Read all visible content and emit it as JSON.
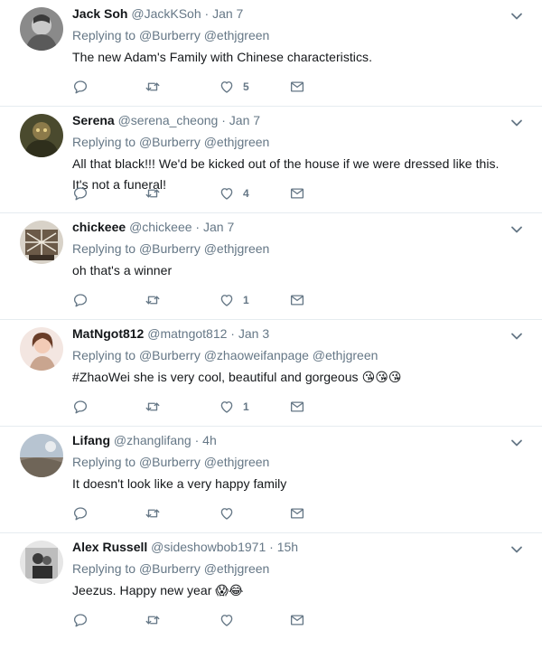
{
  "colors": {
    "secondary_text": "#657786",
    "primary_text": "#14171a",
    "divider": "#e6ecf0"
  },
  "icons": {
    "reply": "reply-icon",
    "retweet": "retweet-icon",
    "like": "heart-icon",
    "message": "envelope-icon",
    "more": "chevron-down-icon"
  },
  "tweets": [
    {
      "name": "Jack Soh",
      "handle": "@JackKSoh",
      "separator": "·",
      "time": "Jan 7",
      "replying_prefix": "Replying to",
      "mentions": "@Burberry @ethjgreen",
      "text": "The new Adam's Family with Chinese characteristics.",
      "likes": "5"
    },
    {
      "name": "Serena",
      "handle": "@serena_cheong",
      "separator": "·",
      "time": "Jan 7",
      "replying_prefix": "Replying to",
      "mentions": "@Burberry @ethjgreen",
      "text": "All that black!!! We'd be kicked out of the house if we were dressed like this. It's not a funeral!",
      "likes": "4"
    },
    {
      "name": "chickeee",
      "handle": "@chickeee",
      "separator": "·",
      "time": "Jan 7",
      "replying_prefix": "Replying to",
      "mentions": "@Burberry @ethjgreen",
      "text": "oh that's a winner",
      "likes": "1"
    },
    {
      "name": "MatNgot812",
      "handle": "@matngot812",
      "separator": "·",
      "time": "Jan 3",
      "replying_prefix": "Replying to",
      "mentions": "@Burberry @zhaoweifanpage @ethjgreen",
      "text": "#ZhaoWei she is very cool, beautiful and gorgeous",
      "emojis": "😘😘😘",
      "likes": "1"
    },
    {
      "name": "Lifang",
      "handle": "@zhanglifang",
      "separator": "·",
      "time": "4h",
      "replying_prefix": "Replying to",
      "mentions": "@Burberry @ethjgreen",
      "text": "It doesn't look like a very happy family",
      "likes": ""
    },
    {
      "name": "Alex Russell",
      "handle": "@sideshowbob1971",
      "separator": "·",
      "time": "15h",
      "replying_prefix": "Replying to",
      "mentions": "@Burberry @ethjgreen",
      "text": "Jeezus. Happy new year",
      "emojis": "😱😂",
      "likes": ""
    }
  ]
}
